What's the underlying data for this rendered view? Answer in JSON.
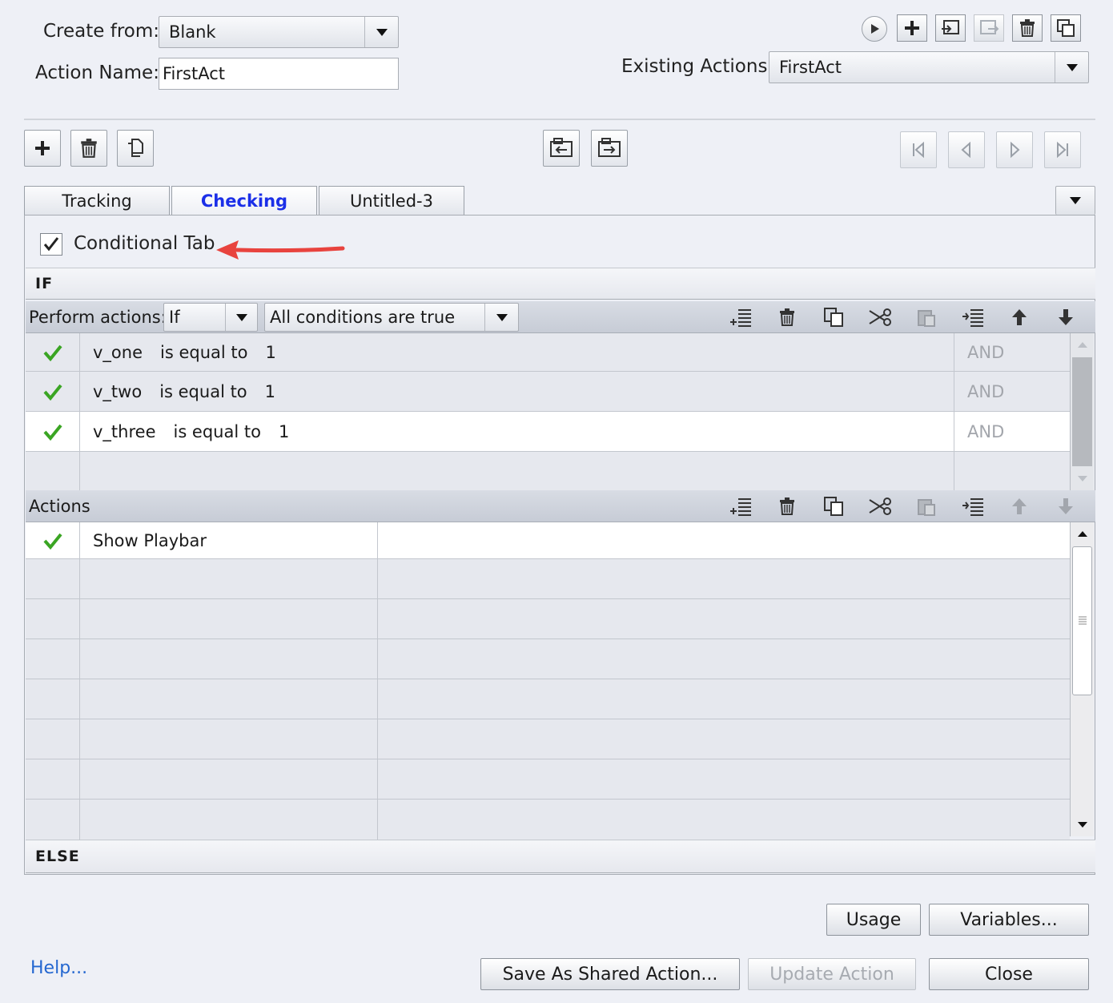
{
  "top": {
    "create_from_label": "Create from:",
    "create_from_value": "Blank",
    "action_name_label": "Action Name:",
    "action_name_value": "FirstAct",
    "existing_actions_label": "Existing Actions:",
    "existing_actions_value": "FirstAct",
    "icons": [
      "preview-play-icon",
      "add-action-icon",
      "import-action-icon",
      "export-action-icon",
      "delete-action-icon",
      "duplicate-action-icon"
    ]
  },
  "toolbar": {
    "left_icons": [
      "add-decision-icon",
      "delete-decision-icon",
      "duplicate-decision-icon"
    ],
    "middle_icons": [
      "move-decision-left-icon",
      "move-decision-right-icon"
    ],
    "nav_icons": [
      "first-decision-icon",
      "previous-decision-icon",
      "next-decision-icon",
      "last-decision-icon"
    ]
  },
  "tabs": [
    {
      "label": "Tracking",
      "active": false
    },
    {
      "label": "Checking",
      "active": true
    },
    {
      "label": "Untitled-3",
      "active": false
    }
  ],
  "conditional": {
    "label": "Conditional Tab",
    "checked": true
  },
  "if_section": {
    "title": "IF",
    "perform_label": "Perform actions:",
    "perform_value": "If",
    "condition_mode": "All conditions are true",
    "conditions": [
      {
        "variable": "v_one",
        "operator": "is equal to",
        "value": "1",
        "joiner": "AND"
      },
      {
        "variable": "v_two",
        "operator": "is equal to",
        "value": "1",
        "joiner": "AND"
      },
      {
        "variable": "v_three",
        "operator": "is equal to",
        "value": "1",
        "joiner": "AND"
      }
    ]
  },
  "actions_section": {
    "title": "Actions",
    "items": [
      {
        "action": "Show Playbar",
        "detail": ""
      }
    ]
  },
  "else_section": {
    "title": "ELSE"
  },
  "footer": {
    "help": "Help...",
    "usage": "Usage",
    "variables": "Variables...",
    "save_shared": "Save As Shared Action...",
    "update": "Update Action",
    "close": "Close"
  },
  "colors": {
    "active_tab": "#1b2fe8",
    "check": "#3aa523",
    "arrow": "#e8433e",
    "link": "#2467d0"
  }
}
